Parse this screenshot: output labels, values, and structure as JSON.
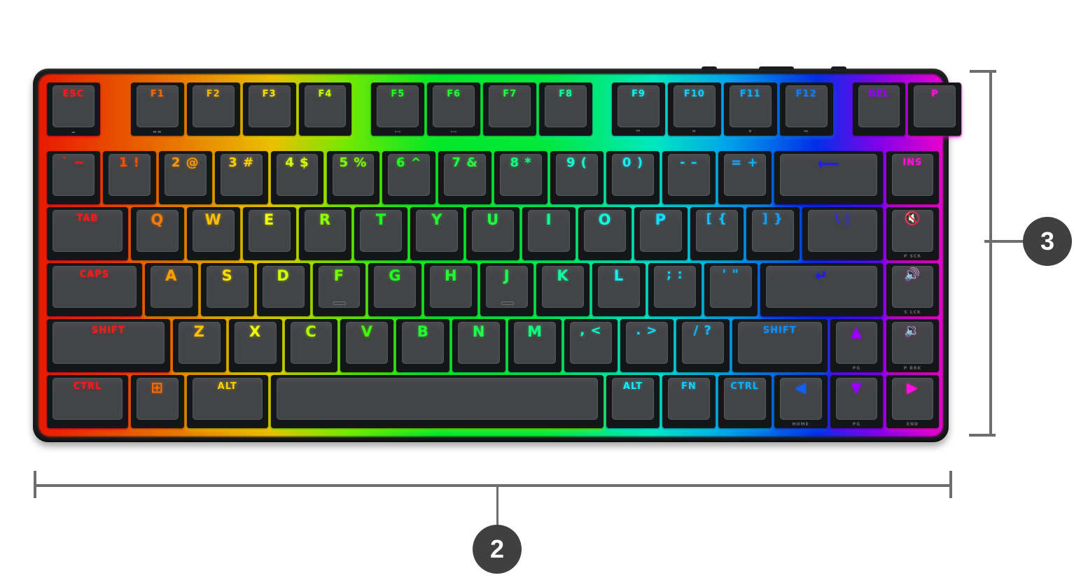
{
  "image": {
    "subject": "RGB tenkeyless mechanical keyboard, top view with dimension callouts",
    "backlight_palette": [
      "#ff1a1a",
      "#ff6a00",
      "#ffb000",
      "#ffe000",
      "#9dff00",
      "#00ff30",
      "#00ffb0",
      "#00d0ff",
      "#0090ff",
      "#2030ff",
      "#9a00ff",
      "#ff10e0"
    ]
  },
  "callouts": {
    "width_marker": "2",
    "height_marker": "3"
  },
  "rows": [
    [
      {
        "label": "ESC",
        "color": "#ff1a1a",
        "sub": "☁",
        "w": 1,
        "gap": 0
      },
      {
        "label": "F1",
        "color": "#ff6a00",
        "sub": "▬▬",
        "w": 1,
        "gap": 0.5
      },
      {
        "label": "F2",
        "color": "#ffb000",
        "w": 1
      },
      {
        "label": "F3",
        "color": "#ffe000",
        "w": 1
      },
      {
        "label": "F4",
        "color": "#c8ff00",
        "w": 1
      },
      {
        "label": "F5",
        "color": "#20ff20",
        "sub": "⟷",
        "w": 1,
        "gap": 0.3
      },
      {
        "label": "F6",
        "color": "#20ff30",
        "sub": "⟷",
        "w": 1
      },
      {
        "label": "F7",
        "color": "#20ff40",
        "w": 1
      },
      {
        "label": "F8",
        "color": "#10ffa0",
        "w": 1
      },
      {
        "label": "F9",
        "color": "#10f0f0",
        "sub": "⏮",
        "w": 1,
        "gap": 0.3
      },
      {
        "label": "F10",
        "color": "#10d0ff",
        "sub": "⏯",
        "w": 1
      },
      {
        "label": "F11",
        "color": "#10b0ff",
        "sub": "⏹",
        "w": 1
      },
      {
        "label": "F12",
        "color": "#1080ff",
        "sub": "⏭",
        "w": 1
      },
      {
        "label": "DEL",
        "color": "#9a00ff",
        "w": 1,
        "gap": 0.3
      },
      {
        "label": "P",
        "color": "#ff10e0",
        "w": 1
      }
    ],
    [
      {
        "label": "` ~",
        "color": "#ff1a1a",
        "w": 1
      },
      {
        "label": "1 !",
        "color": "#ff5000",
        "w": 1
      },
      {
        "label": "2 @",
        "color": "#ff9a00",
        "w": 1
      },
      {
        "label": "3 #",
        "color": "#ffd000",
        "w": 1
      },
      {
        "label": "4 $",
        "color": "#d8ff00",
        "w": 1
      },
      {
        "label": "5 %",
        "color": "#80ff00",
        "w": 1
      },
      {
        "label": "6 ^",
        "color": "#20ff20",
        "w": 1
      },
      {
        "label": "7 &",
        "color": "#20ff40",
        "w": 1
      },
      {
        "label": "8 *",
        "color": "#10ff80",
        "w": 1
      },
      {
        "label": "9 (",
        "color": "#10ffd0",
        "w": 1
      },
      {
        "label": "0 )",
        "color": "#10f0ff",
        "w": 1
      },
      {
        "label": "- –",
        "color": "#10d0ff",
        "w": 1
      },
      {
        "label": "= +",
        "color": "#10b0ff",
        "w": 1
      },
      {
        "label": "⟵",
        "color": "#1a1aff",
        "w": 2
      },
      {
        "label": "INS",
        "color": "#ff10e0",
        "w": 1
      }
    ],
    [
      {
        "label": "TAB",
        "color": "#ff1a1a",
        "w": 1.5
      },
      {
        "label": "Q",
        "color": "#ff7a00",
        "w": 1
      },
      {
        "label": "W",
        "color": "#ffc000",
        "w": 1
      },
      {
        "label": "E",
        "color": "#f0ff00",
        "w": 1
      },
      {
        "label": "R",
        "color": "#90ff00",
        "w": 1
      },
      {
        "label": "T",
        "color": "#20ff20",
        "w": 1
      },
      {
        "label": "Y",
        "color": "#20ff30",
        "w": 1
      },
      {
        "label": "U",
        "color": "#20ff40",
        "w": 1
      },
      {
        "label": "I",
        "color": "#10ff90",
        "w": 1
      },
      {
        "label": "O",
        "color": "#10ffe0",
        "w": 1
      },
      {
        "label": "P",
        "color": "#10e0ff",
        "w": 1
      },
      {
        "label": "[ {",
        "color": "#10c0ff",
        "w": 1
      },
      {
        "label": "] }",
        "color": "#10a0ff",
        "w": 1
      },
      {
        "label": "\\ |",
        "color": "#2a2aff",
        "w": 1.5
      },
      {
        "label": "🔇",
        "color": "#ff10e0",
        "sub": "P SCR",
        "w": 1
      }
    ],
    [
      {
        "label": "CAPS",
        "color": "#ff1a1a",
        "w": 1.75
      },
      {
        "label": "A",
        "color": "#ffa000",
        "w": 1
      },
      {
        "label": "S",
        "color": "#ffe000",
        "w": 1
      },
      {
        "label": "D",
        "color": "#d0ff00",
        "w": 1
      },
      {
        "label": "F",
        "color": "#70ff00",
        "nub": true,
        "w": 1
      },
      {
        "label": "G",
        "color": "#20ff20",
        "w": 1
      },
      {
        "label": "H",
        "color": "#20ff30",
        "w": 1
      },
      {
        "label": "J",
        "color": "#20ff50",
        "nub": true,
        "w": 1
      },
      {
        "label": "K",
        "color": "#10ffa0",
        "w": 1
      },
      {
        "label": "L",
        "color": "#10f0f0",
        "w": 1
      },
      {
        "label": "; :",
        "color": "#10d0ff",
        "w": 1
      },
      {
        "label": "' \"",
        "color": "#10b0ff",
        "w": 1
      },
      {
        "label": "↵",
        "color": "#1a1aff",
        "w": 2.25
      },
      {
        "label": "🔊",
        "color": "#ff10e0",
        "sub": "S LCK",
        "w": 1
      }
    ],
    [
      {
        "label": "SHIFT",
        "color": "#ff1a1a",
        "w": 2.25
      },
      {
        "label": "Z",
        "color": "#ffc000",
        "w": 1
      },
      {
        "label": "X",
        "color": "#f0ff00",
        "w": 1
      },
      {
        "label": "C",
        "color": "#b0ff00",
        "w": 1
      },
      {
        "label": "V",
        "color": "#40ff00",
        "w": 1
      },
      {
        "label": "B",
        "color": "#20ff30",
        "w": 1
      },
      {
        "label": "N",
        "color": "#20ff50",
        "w": 1
      },
      {
        "label": "M",
        "color": "#10ff80",
        "w": 1
      },
      {
        "label": ", <",
        "color": "#10ffd0",
        "w": 1
      },
      {
        "label": ". >",
        "color": "#10e0ff",
        "w": 1
      },
      {
        "label": "/ ?",
        "color": "#10c0ff",
        "w": 1
      },
      {
        "label": "SHIFT",
        "color": "#1090ff",
        "w": 1.75
      },
      {
        "label": "▲",
        "color": "#9a00ff",
        "sub": "PG",
        "w": 1
      },
      {
        "label": "🔉",
        "color": "#ff10e0",
        "sub": "P BRK",
        "w": 1
      }
    ],
    [
      {
        "label": "CTRL",
        "color": "#ff1a1a",
        "w": 1.5
      },
      {
        "label": "⊞",
        "color": "#ff6a00",
        "w": 1
      },
      {
        "label": "ALT",
        "color": "#ffd000",
        "w": 1.5
      },
      {
        "label": "",
        "color": "#80ff00",
        "w": 6
      },
      {
        "label": "ALT",
        "color": "#10f0ff",
        "w": 1
      },
      {
        "label": "FN",
        "color": "#10d0ff",
        "w": 1
      },
      {
        "label": "CTRL",
        "color": "#10b0ff",
        "w": 1
      },
      {
        "label": "◀",
        "color": "#1060ff",
        "sub": "HOME",
        "w": 1
      },
      {
        "label": "▼",
        "color": "#9a00ff",
        "sub": "PG",
        "w": 1
      },
      {
        "label": "▶",
        "color": "#ff10e0",
        "sub": "END",
        "w": 1
      }
    ]
  ]
}
